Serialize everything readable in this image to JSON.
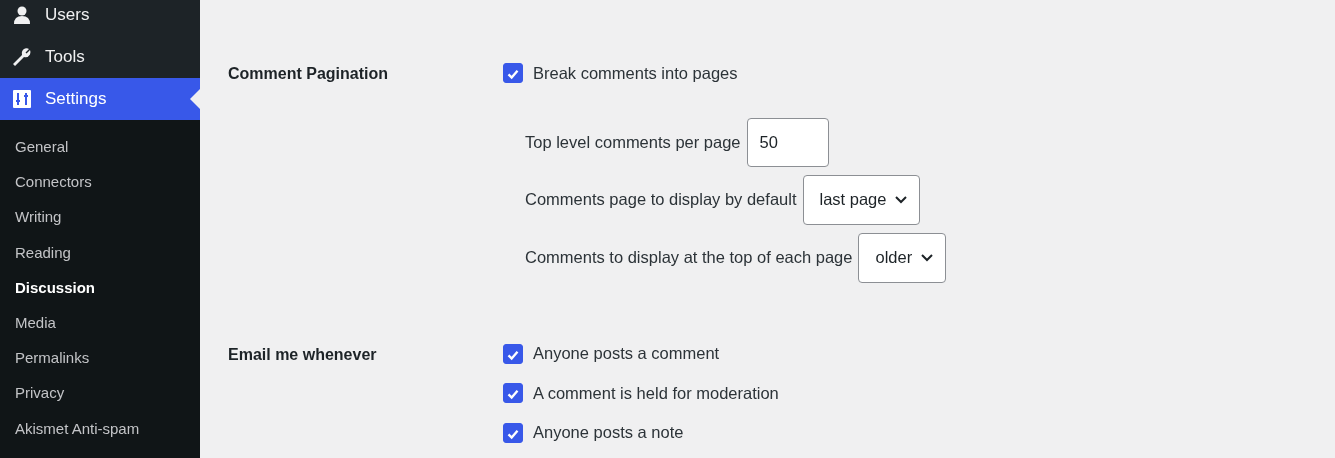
{
  "sidebar": {
    "menu": [
      {
        "label": "Users",
        "selected": false
      },
      {
        "label": "Tools",
        "selected": false
      },
      {
        "label": "Settings",
        "selected": true
      }
    ],
    "submenu": [
      {
        "label": "General",
        "selected": false
      },
      {
        "label": "Connectors",
        "selected": false
      },
      {
        "label": "Writing",
        "selected": false
      },
      {
        "label": "Reading",
        "selected": false
      },
      {
        "label": "Discussion",
        "selected": true
      },
      {
        "label": "Media",
        "selected": false
      },
      {
        "label": "Permalinks",
        "selected": false
      },
      {
        "label": "Privacy",
        "selected": false
      },
      {
        "label": "Akismet Anti-spam",
        "selected": false
      }
    ]
  },
  "settings": [
    {
      "label": "Comment Pagination",
      "options": [
        {
          "label": "Break comments into pages",
          "checked": true
        }
      ],
      "fields": [
        {
          "kind": "input",
          "label": "Top level comments per page",
          "value": "50"
        },
        {
          "kind": "select",
          "label": "Comments page to display by default",
          "value": "last page"
        },
        {
          "kind": "select",
          "label": "Comments to display at the top of each page",
          "value": "older"
        }
      ]
    },
    {
      "label": "Email me whenever",
      "options": [
        {
          "label": "Anyone posts a comment",
          "checked": true
        },
        {
          "label": "A comment is held for moderation",
          "checked": true
        },
        {
          "label": "Anyone posts a note",
          "checked": true
        }
      ]
    }
  ]
}
